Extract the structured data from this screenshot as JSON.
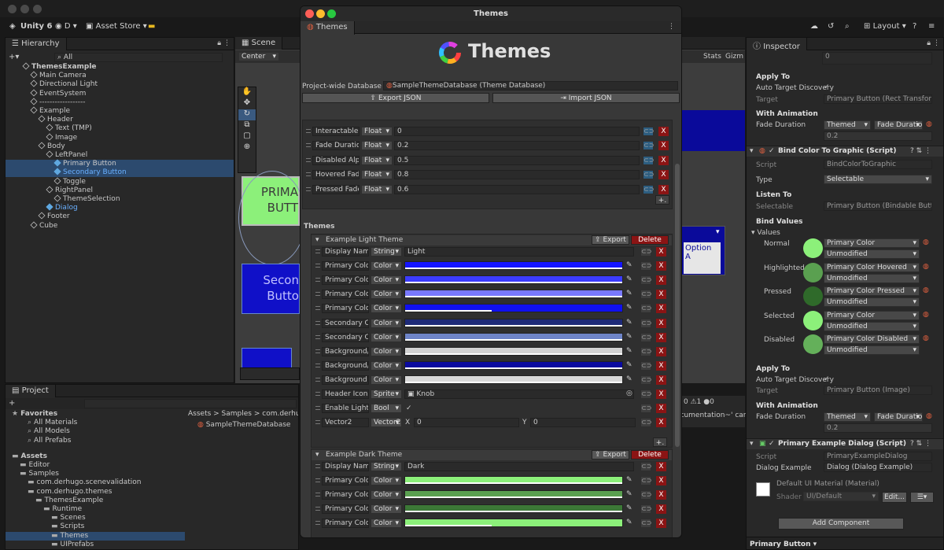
{
  "toolbar": {
    "unity": "Unity 6",
    "account": "D",
    "asset_store": "Asset Store",
    "layout": "Layout"
  },
  "hierarchy": {
    "tab": "Hierarchy",
    "search_placeholder": "All",
    "items": [
      {
        "label": "ThemesExample",
        "depth": 0
      },
      {
        "label": "Main Camera",
        "depth": 1
      },
      {
        "label": "Directional Light",
        "depth": 1
      },
      {
        "label": "EventSystem",
        "depth": 1
      },
      {
        "label": "------------------",
        "depth": 1
      },
      {
        "label": "Example",
        "depth": 1
      },
      {
        "label": "Header",
        "depth": 2
      },
      {
        "label": "Text (TMP)",
        "depth": 3
      },
      {
        "label": "Image",
        "depth": 3
      },
      {
        "label": "Body",
        "depth": 2
      },
      {
        "label": "LeftPanel",
        "depth": 3
      },
      {
        "label": "Primary Button",
        "depth": 4
      },
      {
        "label": "Secondary Button",
        "depth": 4
      },
      {
        "label": "Toggle",
        "depth": 4
      },
      {
        "label": "RightPanel",
        "depth": 3
      },
      {
        "label": "ThemeSelection",
        "depth": 4
      },
      {
        "label": "Dialog",
        "depth": 3
      },
      {
        "label": "Footer",
        "depth": 2
      },
      {
        "label": "Cube",
        "depth": 1
      }
    ]
  },
  "scene": {
    "tab": "Scene",
    "pivot": "Center",
    "stats": "Stats",
    "gizmos": "Gizm",
    "primary_text": "PRIMA BUTT",
    "secondary_text": "Secon Butto",
    "option": "Option A"
  },
  "project": {
    "tab": "Project",
    "favorites": "Favorites",
    "fav_items": [
      "All Materials",
      "All Models",
      "All Prefabs"
    ],
    "assets": "Assets",
    "tree": [
      "Editor",
      "Samples",
      "com.derhugo.scenevalidation",
      "com.derhugo.themes",
      "ThemesExample",
      "Runtime",
      "Scenes",
      "Scripts",
      "Themes",
      "UIPrefabs"
    ],
    "breadcrumb": "Assets > Samples > com.derhugo.",
    "file": "SampleThemeDatabase"
  },
  "console": {
    "errors": "0",
    "warnings": "1",
    "logs": "0",
    "msg": "ocumentation~' can't"
  },
  "modal": {
    "window_title": "Themes",
    "tab": "Themes",
    "heading": "Themes",
    "db_label": "Project-wide Database",
    "db_value": "SampleThemeDatabase (Theme Database)",
    "export_json": "Export JSON",
    "import_json": "Import JSON",
    "globals": [
      {
        "name": "Interactable Pr",
        "type": "Float",
        "value": "0"
      },
      {
        "name": "Fade Duration",
        "type": "Float",
        "value": "0.2"
      },
      {
        "name": "Disabled Alpha",
        "type": "Float",
        "value": "0.5"
      },
      {
        "name": "Hovered Fade",
        "type": "Float",
        "value": "0.8"
      },
      {
        "name": "Pressed Fade",
        "type": "Float",
        "value": "0.6"
      }
    ],
    "themes_label": "Themes",
    "export": "Export",
    "delete": "Delete",
    "light_title": "Example Light Theme",
    "dark_title": "Example Dark Theme",
    "light_rows": [
      {
        "name": "Display Name",
        "type": "String",
        "kind": "text",
        "value": "Light"
      },
      {
        "name": "Primary Color",
        "type": "Color",
        "kind": "color",
        "color": "#1414ff",
        "alpha": 1
      },
      {
        "name": "Primary Color",
        "type": "Color",
        "kind": "color",
        "color": "#3c3cff",
        "alpha": 1
      },
      {
        "name": "Primary Color",
        "type": "Color",
        "kind": "color",
        "color": "#7878ff",
        "alpha": 1
      },
      {
        "name": "Primary Color",
        "type": "Color",
        "kind": "color",
        "color": "#1010f0",
        "alpha": 0.4
      },
      {
        "name": "Secondary Col",
        "type": "Color",
        "kind": "color",
        "color": "#1e2a78",
        "alpha": 1
      },
      {
        "name": "Secondary Off",
        "type": "Color",
        "kind": "color",
        "color": "#6e84c8",
        "alpha": 1
      },
      {
        "name": "Background/Pr",
        "type": "Color",
        "kind": "color",
        "color": "#d2d2d2",
        "alpha": 1
      },
      {
        "name": "Background/Se",
        "type": "Color",
        "kind": "color",
        "color": "#0a0aa0",
        "alpha": 1
      },
      {
        "name": "Background Se",
        "type": "Color",
        "kind": "color",
        "color": "#d8d8d8",
        "alpha": 1
      },
      {
        "name": "Header Icon",
        "type": "Sprite",
        "kind": "object",
        "value": "Knob"
      },
      {
        "name": "Enable Light",
        "type": "Bool",
        "kind": "bool",
        "value": "✓"
      },
      {
        "name": "Vector2",
        "type": "Vector2",
        "kind": "vector",
        "x": "0",
        "y": "0"
      }
    ],
    "dark_rows": [
      {
        "name": "Display Name",
        "type": "String",
        "kind": "text",
        "value": "Dark"
      },
      {
        "name": "Primary Color",
        "type": "Color",
        "kind": "color",
        "color": "#8cf07a",
        "alpha": 1
      },
      {
        "name": "Primary Color",
        "type": "Color",
        "kind": "color",
        "color": "#5aa050",
        "alpha": 1
      },
      {
        "name": "Primary Color",
        "type": "Color",
        "kind": "color",
        "color": "#3c7837",
        "alpha": 1
      },
      {
        "name": "Primary Color",
        "type": "Color",
        "kind": "color",
        "color": "#8cf07a",
        "alpha": 0.4
      }
    ]
  },
  "inspector": {
    "tab": "Inspector",
    "apply_to": "Apply To",
    "auto_target": "Auto Target Discovery",
    "target": "Target",
    "target_val1": "Primary Button (Rect Transform)",
    "with_anim": "With Animation",
    "fade_duration": "Fade Duration",
    "themed": "Themed",
    "fade_dur_drop": "Fade Duration",
    "fade_val": "0.2",
    "component": "Bind Color To Graphic (Script)",
    "script": "Script",
    "script_val": "BindColorToGraphic",
    "type": "Type",
    "type_val": "Selectable",
    "listen_to": "Listen To",
    "selectable": "Selectable",
    "selectable_val": "Primary Button (Bindable Button)",
    "bind_values": "Bind Values",
    "values": "Values",
    "states": [
      {
        "label": "Normal",
        "color": "#8cf07a",
        "theme": "Primary Color",
        "mod": "Unmodified"
      },
      {
        "label": "Highlighted",
        "color": "#5aa050",
        "theme": "Primary Color Hovered",
        "mod": "Unmodified"
      },
      {
        "label": "Pressed",
        "color": "#2f6a2a",
        "theme": "Primary Color Pressed",
        "mod": "Unmodified"
      },
      {
        "label": "Selected",
        "color": "#8cf07a",
        "theme": "Primary Color",
        "mod": "Unmodified"
      },
      {
        "label": "Disabled",
        "color": "#64b05a",
        "theme": "Primary Color Disabled",
        "mod": "Unmodified"
      }
    ],
    "apply_to2": "Apply To",
    "auto_target2": "Auto Target Discovery",
    "target2": "Target",
    "target_val2": "Primary Button (Image)",
    "with_anim2": "With Animation",
    "fade_duration2": "Fade Duration",
    "themed2": "Themed",
    "fade_dur_drop2": "Fade Duration",
    "fade_val2": "0.2",
    "dialog_comp": "Primary Example Dialog (Script)",
    "script2": "Script",
    "script_val2": "PrimaryExampleDialog",
    "dialog_example": "Dialog Example",
    "dialog_val": "Dialog (Dialog Example)",
    "material": "Default UI Material (Material)",
    "shader": "Shader",
    "shader_val": "UI/Default",
    "edit": "Edit...",
    "add_component": "Add Component",
    "footer": "Primary Button",
    "top_value": "0"
  }
}
